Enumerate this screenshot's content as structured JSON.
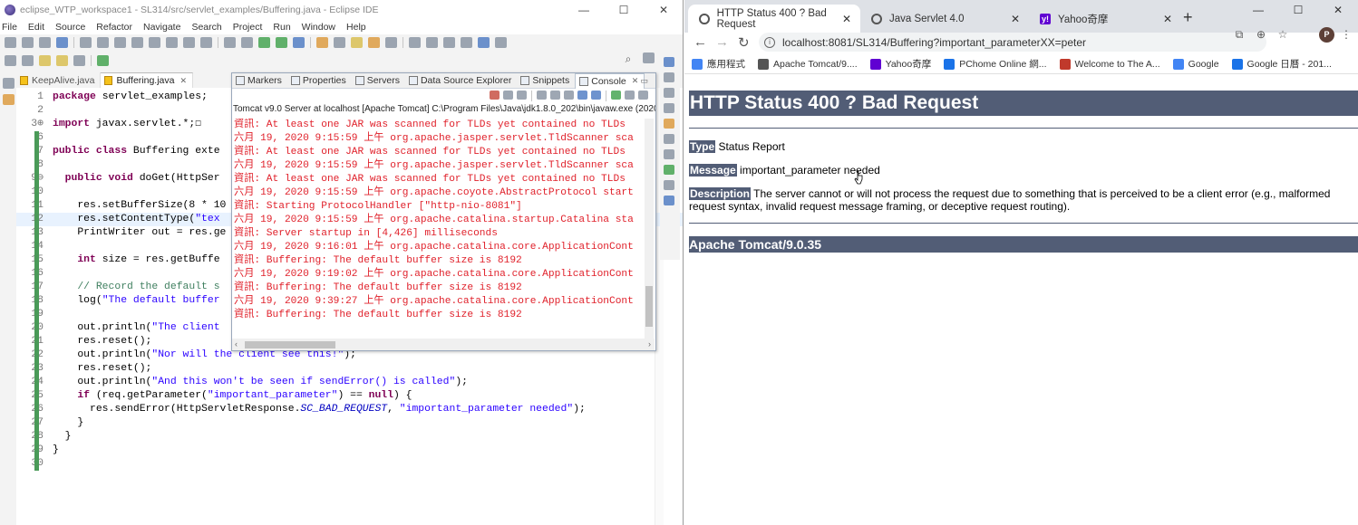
{
  "eclipse": {
    "title": "eclipse_WTP_workspace1 - SL314/src/servlet_examples/Buffering.java - Eclipse IDE",
    "menu": [
      "File",
      "Edit",
      "Source",
      "Refactor",
      "Navigate",
      "Search",
      "Project",
      "Run",
      "Window",
      "Help"
    ],
    "editor_tabs": [
      {
        "label": "KeepAlive.java",
        "active": false
      },
      {
        "label": "Buffering.java",
        "active": true
      }
    ],
    "code_lines": [
      {
        "n": "1",
        "html": "<span class=\"kw\">package</span> servlet_examples;"
      },
      {
        "n": "2",
        "html": ""
      },
      {
        "n": "3⊕",
        "html": "<span class=\"kw\">import</span> javax.servlet.*;☐"
      },
      {
        "n": "6",
        "html": ""
      },
      {
        "n": "7",
        "html": "<span class=\"kw\">public class</span> Buffering exte"
      },
      {
        "n": "8",
        "html": ""
      },
      {
        "n": "9⊖",
        "html": "  <span class=\"kw\">public void</span> doGet(HttpSer"
      },
      {
        "n": "10",
        "html": ""
      },
      {
        "n": "11",
        "html": "    res.setBufferSize(8 * 10"
      },
      {
        "n": "12",
        "html": "    res.setContentType(<span class=\"str\">\"tex</span>"
      },
      {
        "n": "13",
        "html": "    PrintWriter out = res.ge"
      },
      {
        "n": "14",
        "html": ""
      },
      {
        "n": "15",
        "html": "    <span class=\"kw\">int</span> size = res.getBuffe"
      },
      {
        "n": "16",
        "html": ""
      },
      {
        "n": "17",
        "html": "    <span class=\"cm\">// Record the default s</span>"
      },
      {
        "n": "18",
        "html": "    log(<span class=\"str\">\"The default buffer</span>"
      },
      {
        "n": "19",
        "html": ""
      },
      {
        "n": "20",
        "html": "    out.println(<span class=\"str\">\"The client</span>"
      },
      {
        "n": "21",
        "html": "    res.reset();"
      },
      {
        "n": "22",
        "html": "    out.println(<span class=\"str\">\"Nor will the client see this!\"</span>);"
      },
      {
        "n": "23",
        "html": "    res.reset();"
      },
      {
        "n": "24",
        "html": "    out.println(<span class=\"str\">\"And this won't be seen if sendError() is called\"</span>);"
      },
      {
        "n": "25",
        "html": "    <span class=\"kw\">if</span> (req.getParameter(<span class=\"str\">\"important_parameter\"</span>) == <span class=\"kw\">null</span>) {"
      },
      {
        "n": "26",
        "html": "      res.sendError(HttpServletResponse.<span class=\"it\">SC_BAD_REQUEST</span>, <span class=\"str\">\"important_parameter needed\"</span>);"
      },
      {
        "n": "27",
        "html": "    }"
      },
      {
        "n": "28",
        "html": "  }"
      },
      {
        "n": "29",
        "html": "}"
      },
      {
        "n": "30",
        "html": ""
      }
    ],
    "view_tabs": [
      {
        "label": "Markers",
        "active": false
      },
      {
        "label": "Properties",
        "active": false
      },
      {
        "label": "Servers",
        "active": false
      },
      {
        "label": "Data Source Explorer",
        "active": false
      },
      {
        "label": "Snippets",
        "active": false
      },
      {
        "label": "Console",
        "active": true
      }
    ],
    "console_label": "Tomcat v9.0 Server at localhost [Apache Tomcat] C:\\Program Files\\Java\\jdk1.8.0_202\\bin\\javaw.exe (2020",
    "console_lines": [
      "資訊: At least one JAR was scanned for TLDs yet contained no TLDs",
      "六月 19, 2020 9:15:59 上午 org.apache.jasper.servlet.TldScanner sca",
      "資訊: At least one JAR was scanned for TLDs yet contained no TLDs",
      "六月 19, 2020 9:15:59 上午 org.apache.jasper.servlet.TldScanner sca",
      "資訊: At least one JAR was scanned for TLDs yet contained no TLDs",
      "六月 19, 2020 9:15:59 上午 org.apache.coyote.AbstractProtocol start",
      "資訊: Starting ProtocolHandler [\"http-nio-8081\"]",
      "六月 19, 2020 9:15:59 上午 org.apache.catalina.startup.Catalina sta",
      "資訊: Server startup in [4,426] milliseconds",
      "六月 19, 2020 9:16:01 上午 org.apache.catalina.core.ApplicationCont",
      "資訊: Buffering: The default buffer size is 8192",
      "六月 19, 2020 9:19:02 上午 org.apache.catalina.core.ApplicationCont",
      "資訊: Buffering: The default buffer size is 8192",
      "六月 19, 2020 9:39:27 上午 org.apache.catalina.core.ApplicationCont",
      "資訊: Buffering: The default buffer size is 8192"
    ]
  },
  "chrome": {
    "tabs": [
      {
        "label": "HTTP Status 400 ? Bad Request",
        "active": true,
        "icon": "globe-icon"
      },
      {
        "label": "Java Servlet 4.0",
        "active": false,
        "icon": "globe-icon"
      },
      {
        "label": "Yahoo奇摩",
        "active": false,
        "icon": "yahoo-icon"
      }
    ],
    "new_tab_glyph": "+",
    "url": "localhost:8081/SL314/Buffering?important_parameterXX=peter",
    "profile_initial": "P",
    "bookmarks": [
      {
        "label": "應用程式",
        "color": "#4285f4"
      },
      {
        "label": "Apache Tomcat/9....",
        "color": "#555555"
      },
      {
        "label": "Yahoo奇摩",
        "color": "#6001d2"
      },
      {
        "label": "PChome Online 網...",
        "color": "#1a73e8"
      },
      {
        "label": "Welcome to The A...",
        "color": "#c0392b"
      },
      {
        "label": "Google",
        "color": "#4285f4"
      },
      {
        "label": "Google 日曆 - 201...",
        "color": "#1a73e8"
      }
    ],
    "page": {
      "heading": "HTTP Status 400 ? Bad Request",
      "type_label": "Type",
      "type_value": "Status Report",
      "message_label": "Message",
      "message_value": "important_parameter needed",
      "description_label": "Description",
      "description_value": "The server cannot or will not process the request due to something that is perceived to be a client error (e.g., malformed request syntax, invalid request message framing, or deceptive request routing).",
      "footer": "Apache Tomcat/9.0.35"
    }
  }
}
